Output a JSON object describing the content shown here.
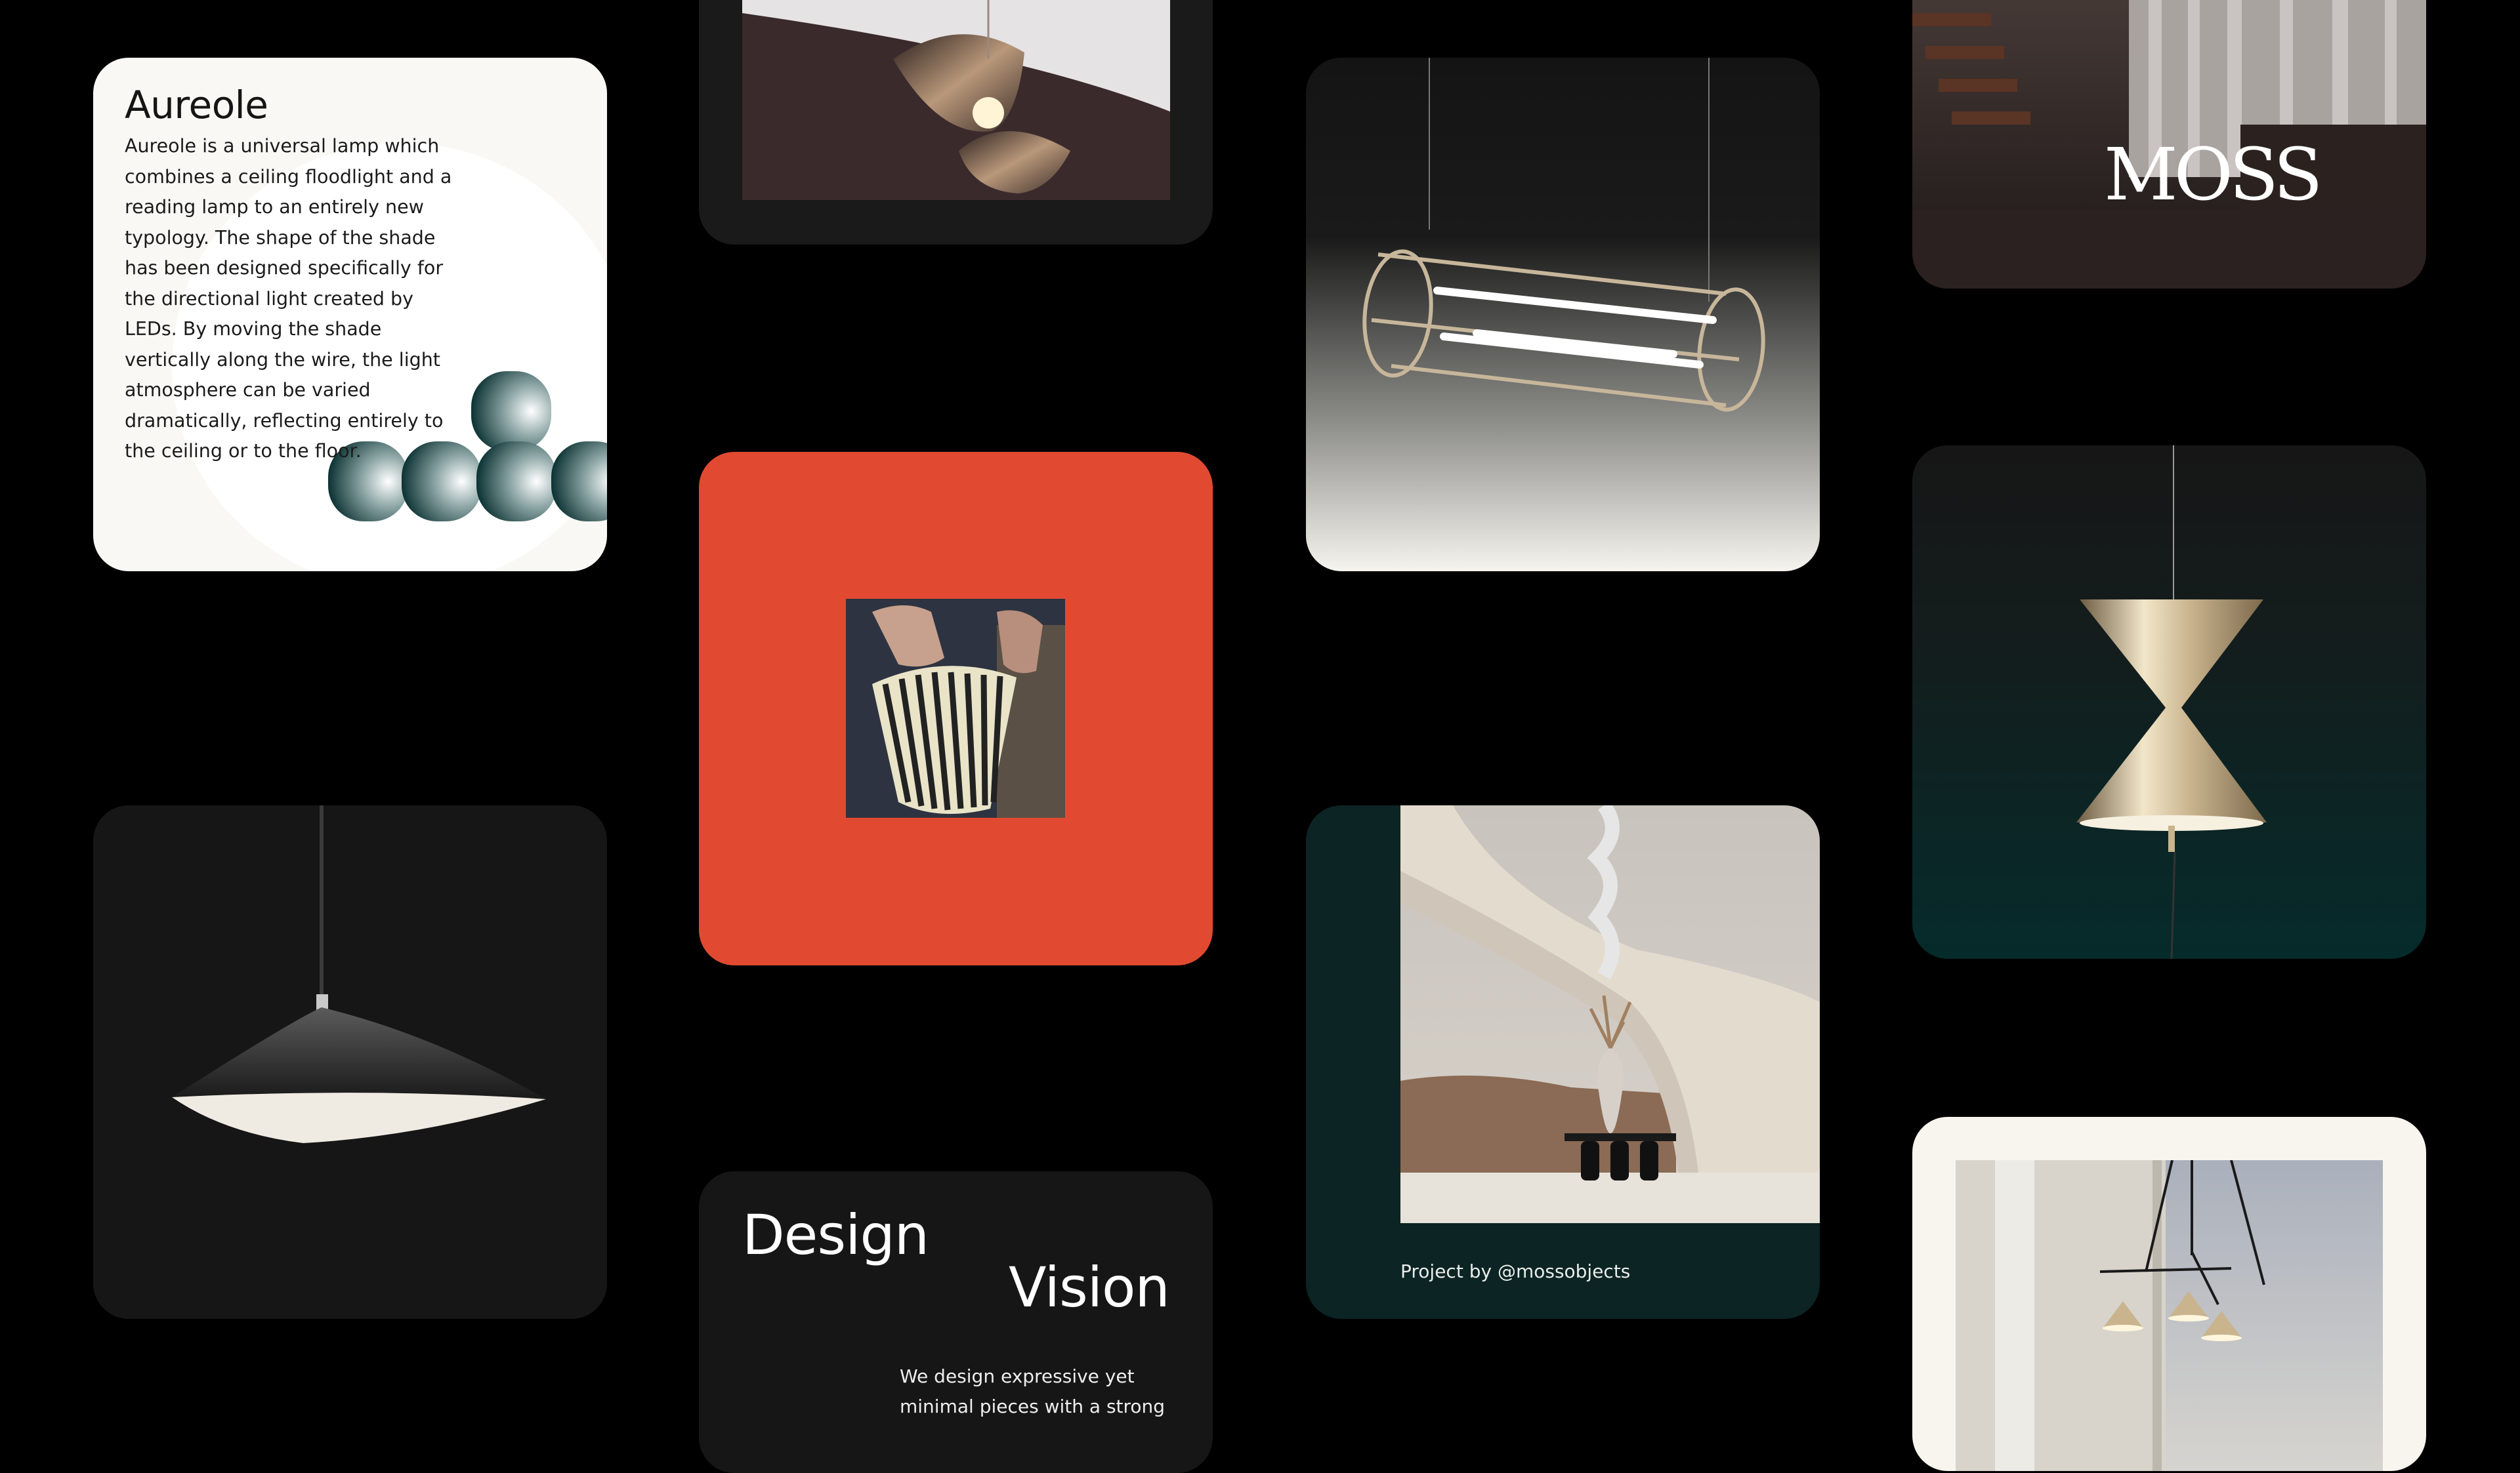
{
  "aureole_card": {
    "title": "Aureole",
    "body": "Aureole is a universal lamp which combines a ceiling floodlight and a reading lamp to an entirely new typology. The shape of the shade has been designed specifically for the directional light created by LEDs. By moving the shade vertically along the wire, the light atmosphere can be varied dramatically, reflecting entirely to the ceiling or to the floor."
  },
  "moss_card": {
    "logo_text": "MOSS"
  },
  "staircase_card": {
    "credit": "Project by @mossobjects"
  },
  "design_card": {
    "word1": "Design",
    "word2": "Vision",
    "text": "We design expressive yet minimal pieces with a strong"
  },
  "colors": {
    "background": "#000000",
    "card_dark": "#161616",
    "card_light": "#faf8f4",
    "accent_orange": "#e14a31",
    "accent_teal": "#0c2423"
  }
}
